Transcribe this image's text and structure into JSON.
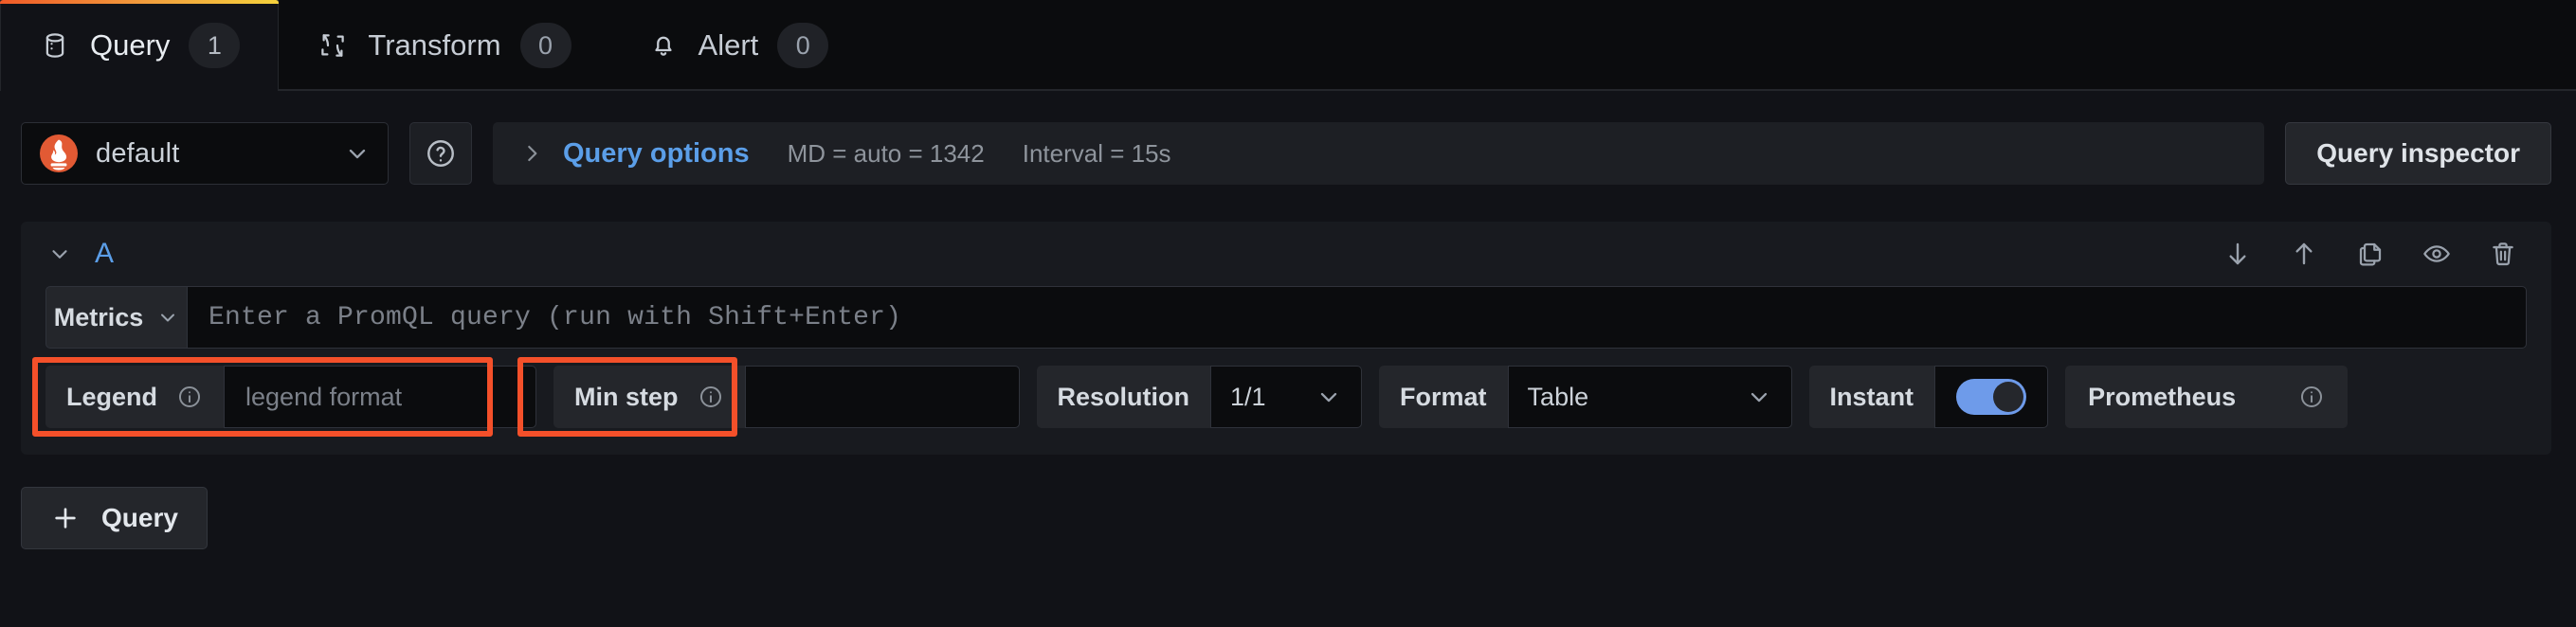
{
  "tabs": [
    {
      "label": "Query",
      "count": "1",
      "icon": "database-icon",
      "active": true
    },
    {
      "label": "Transform",
      "count": "0",
      "icon": "transform-icon",
      "active": false
    },
    {
      "label": "Alert",
      "count": "0",
      "icon": "bell-icon",
      "active": false
    }
  ],
  "datasource": {
    "name": "default",
    "logo": "prometheus-logo",
    "help_icon": "question-circle-icon",
    "chevron": "chevron-down-icon"
  },
  "query_options": {
    "caret": "chevron-right-icon",
    "title": "Query options",
    "max_data_points": "MD = auto = 1342",
    "interval": "Interval = 15s"
  },
  "query_inspector": {
    "label": "Query inspector"
  },
  "query_row": {
    "ref_id": "A",
    "collapse_icon": "chevron-down-icon",
    "actions": [
      {
        "name": "move-query-down-button",
        "icon": "arrow-down-icon"
      },
      {
        "name": "move-query-up-button",
        "icon": "arrow-up-icon"
      },
      {
        "name": "duplicate-query-button",
        "icon": "copy-icon"
      },
      {
        "name": "toggle-query-visibility-button",
        "icon": "eye-icon"
      },
      {
        "name": "remove-query-button",
        "icon": "trash-icon"
      }
    ],
    "metrics_button": "Metrics",
    "promql_placeholder": "Enter a PromQL query (run with Shift+Enter)",
    "promql_value": "",
    "legend": {
      "label": "Legend",
      "placeholder": "legend format",
      "value": "",
      "info_icon": "info-circle-icon"
    },
    "min_step": {
      "label": "Min step",
      "value": "",
      "info_icon": "info-circle-icon"
    },
    "resolution": {
      "label": "Resolution",
      "value": "1/1",
      "chevron": "chevron-down-icon"
    },
    "format": {
      "label": "Format",
      "value": "Table",
      "chevron": "chevron-down-icon",
      "highlighted": true
    },
    "instant": {
      "label": "Instant",
      "enabled": true,
      "highlighted": true
    },
    "query_type": {
      "label": "Prometheus",
      "info_icon": "info-circle-icon"
    }
  },
  "add_query_button": {
    "label": "Query",
    "icon": "plus-icon"
  },
  "colors": {
    "highlight": "#f4502a",
    "accent_blue": "#5b9ee8",
    "toggle_on": "#6e9bea",
    "tab_active_gradient_start": "#f05a28",
    "tab_active_gradient_end": "#f5d13c",
    "panel_bg": "#111217",
    "card_bg": "#181a1f"
  }
}
